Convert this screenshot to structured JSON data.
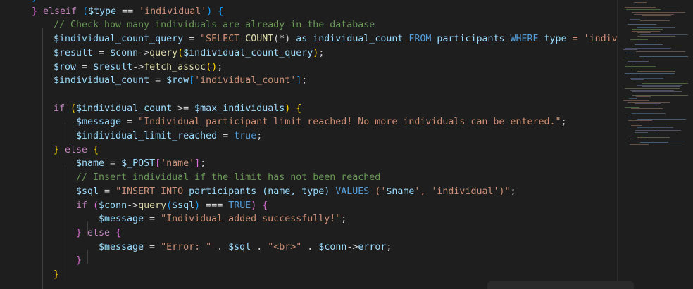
{
  "editor": {
    "language": "php",
    "theme_colors": {
      "background": "#1e1e1e",
      "keyword": "#c586c0",
      "variable": "#9cdcfe",
      "string": "#ce9178",
      "function": "#dcdcaa",
      "comment": "#6a9955",
      "constant": "#569cd6"
    },
    "lines": [
      [
        {
          "t": "}",
          "c": "br3"
        }
      ],
      [
        {
          "t": "} ",
          "c": "br2"
        },
        {
          "t": "elseif",
          "c": "k"
        },
        {
          "t": " ",
          "c": "p"
        },
        {
          "t": "(",
          "c": "br3"
        },
        {
          "t": "$type",
          "c": "v"
        },
        {
          "t": " == ",
          "c": "p"
        },
        {
          "t": "'individual'",
          "c": "s"
        },
        {
          "t": ") ",
          "c": "br3"
        },
        {
          "t": "{",
          "c": "br3"
        }
      ],
      [
        {
          "t": "// Check how many individuals are already in the database",
          "c": "c"
        }
      ],
      [
        {
          "t": "$individual_count_query",
          "c": "v"
        },
        {
          "t": " = ",
          "c": "p"
        },
        {
          "t": "\"SELECT ",
          "c": "s"
        },
        {
          "t": "COUNT",
          "c": "f"
        },
        {
          "t": "(*)",
          "c": "p"
        },
        {
          "t": " as individual_count ",
          "c": "v"
        },
        {
          "t": "FROM",
          "c": "b"
        },
        {
          "t": " participants ",
          "c": "v"
        },
        {
          "t": "WHERE",
          "c": "b"
        },
        {
          "t": " type ",
          "c": "v"
        },
        {
          "t": "= 'indiv",
          "c": "s"
        }
      ],
      [
        {
          "t": "$result",
          "c": "v"
        },
        {
          "t": " = ",
          "c": "p"
        },
        {
          "t": "$conn",
          "c": "v"
        },
        {
          "t": "->",
          "c": "p"
        },
        {
          "t": "query",
          "c": "f"
        },
        {
          "t": "(",
          "c": "br1"
        },
        {
          "t": "$individual_count_query",
          "c": "v"
        },
        {
          "t": ")",
          "c": "br1"
        },
        {
          "t": ";",
          "c": "p"
        }
      ],
      [
        {
          "t": "$row",
          "c": "v"
        },
        {
          "t": " = ",
          "c": "p"
        },
        {
          "t": "$result",
          "c": "v"
        },
        {
          "t": "->",
          "c": "p"
        },
        {
          "t": "fetch_assoc",
          "c": "f"
        },
        {
          "t": "()",
          "c": "br1"
        },
        {
          "t": ";",
          "c": "p"
        }
      ],
      [
        {
          "t": "$individual_count",
          "c": "v"
        },
        {
          "t": " = ",
          "c": "p"
        },
        {
          "t": "$row",
          "c": "v"
        },
        {
          "t": "[",
          "c": "br3"
        },
        {
          "t": "'individual_count'",
          "c": "s"
        },
        {
          "t": "]",
          "c": "br3"
        },
        {
          "t": ";",
          "c": "p"
        }
      ],
      [],
      [
        {
          "t": "if",
          "c": "k"
        },
        {
          "t": " ",
          "c": "p"
        },
        {
          "t": "(",
          "c": "br1"
        },
        {
          "t": "$individual_count",
          "c": "v"
        },
        {
          "t": " >= ",
          "c": "p"
        },
        {
          "t": "$max_individuals",
          "c": "v"
        },
        {
          "t": ") ",
          "c": "br1"
        },
        {
          "t": "{",
          "c": "br1"
        }
      ],
      [
        {
          "t": "$message",
          "c": "v"
        },
        {
          "t": " = ",
          "c": "p"
        },
        {
          "t": "\"Individual participant limit reached! No more individuals can be entered.\"",
          "c": "s"
        },
        {
          "t": ";",
          "c": "p"
        }
      ],
      [
        {
          "t": "$individual_limit_reached",
          "c": "v"
        },
        {
          "t": " = ",
          "c": "p"
        },
        {
          "t": "true",
          "c": "b"
        },
        {
          "t": ";",
          "c": "p"
        }
      ],
      [
        {
          "t": "} ",
          "c": "br1"
        },
        {
          "t": "else",
          "c": "k"
        },
        {
          "t": " ",
          "c": "p"
        },
        {
          "t": "{",
          "c": "br1"
        }
      ],
      [
        {
          "t": "$name",
          "c": "v"
        },
        {
          "t": " = ",
          "c": "p"
        },
        {
          "t": "$_POST",
          "c": "v"
        },
        {
          "t": "[",
          "c": "br2"
        },
        {
          "t": "'name'",
          "c": "s"
        },
        {
          "t": "]",
          "c": "br2"
        },
        {
          "t": ";",
          "c": "p"
        }
      ],
      [
        {
          "t": "// Insert individual if the limit has not been reached",
          "c": "c"
        }
      ],
      [
        {
          "t": "$sql",
          "c": "v"
        },
        {
          "t": " = ",
          "c": "p"
        },
        {
          "t": "\"INSERT INTO ",
          "c": "s"
        },
        {
          "t": "participants (name, type) ",
          "c": "v"
        },
        {
          "t": "VALUES",
          "c": "b"
        },
        {
          "t": " ('",
          "c": "s"
        },
        {
          "t": "$name",
          "c": "v"
        },
        {
          "t": "', 'individual')\"",
          "c": "s"
        },
        {
          "t": ";",
          "c": "p"
        }
      ],
      [
        {
          "t": "if",
          "c": "k"
        },
        {
          "t": " ",
          "c": "p"
        },
        {
          "t": "(",
          "c": "br2"
        },
        {
          "t": "$conn",
          "c": "v"
        },
        {
          "t": "->",
          "c": "p"
        },
        {
          "t": "query",
          "c": "f"
        },
        {
          "t": "(",
          "c": "br3"
        },
        {
          "t": "$sql",
          "c": "v"
        },
        {
          "t": ")",
          "c": "br3"
        },
        {
          "t": " === ",
          "c": "p"
        },
        {
          "t": "TRUE",
          "c": "b"
        },
        {
          "t": ") ",
          "c": "br2"
        },
        {
          "t": "{",
          "c": "br2"
        }
      ],
      [
        {
          "t": "$message",
          "c": "v"
        },
        {
          "t": " = ",
          "c": "p"
        },
        {
          "t": "\"Individual added successfully!\"",
          "c": "s"
        },
        {
          "t": ";",
          "c": "p"
        }
      ],
      [
        {
          "t": "} ",
          "c": "br2"
        },
        {
          "t": "else",
          "c": "k"
        },
        {
          "t": " ",
          "c": "p"
        },
        {
          "t": "{",
          "c": "br2"
        }
      ],
      [
        {
          "t": "$message",
          "c": "v"
        },
        {
          "t": " = ",
          "c": "p"
        },
        {
          "t": "\"Error: \"",
          "c": "s"
        },
        {
          "t": " . ",
          "c": "p"
        },
        {
          "t": "$sql",
          "c": "v"
        },
        {
          "t": " . ",
          "c": "p"
        },
        {
          "t": "\"<br>\"",
          "c": "s"
        },
        {
          "t": " . ",
          "c": "p"
        },
        {
          "t": "$conn",
          "c": "v"
        },
        {
          "t": "->",
          "c": "p"
        },
        {
          "t": "error",
          "c": "v"
        },
        {
          "t": ";",
          "c": "p"
        }
      ],
      [
        {
          "t": "}",
          "c": "br2"
        }
      ],
      [
        {
          "t": "}",
          "c": "br1"
        }
      ]
    ]
  }
}
